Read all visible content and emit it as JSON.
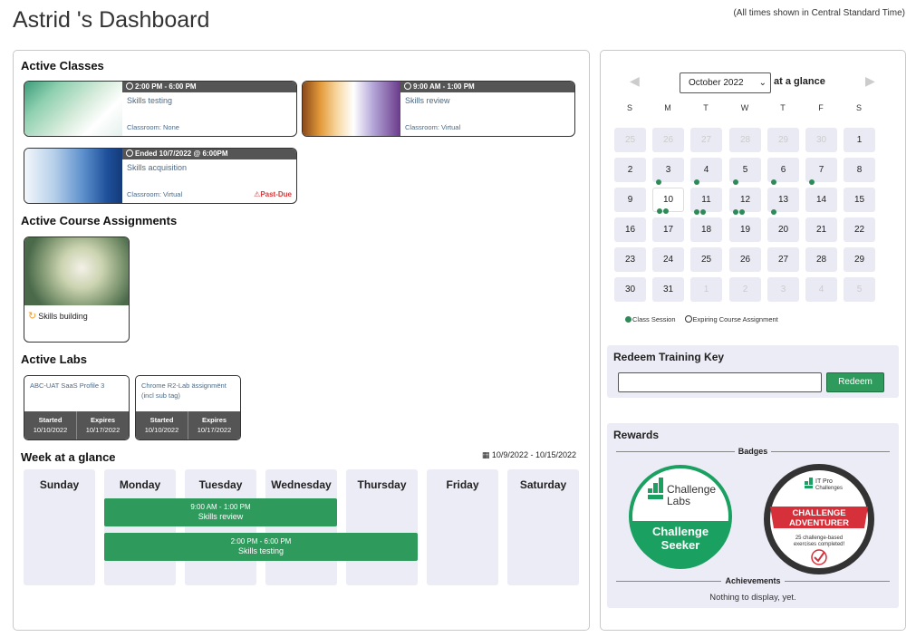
{
  "header": {
    "title": "Astrid 's Dashboard",
    "timezone_note": "(All times shown in Central Standard Time)"
  },
  "active_classes": {
    "title": "Active Classes",
    "cards": [
      {
        "time": "2:00 PM - 6:00 PM",
        "name": "Skills testing",
        "classroom": "Classroom: None",
        "status": ""
      },
      {
        "time": "9:00 AM - 1:00 PM",
        "name": "Skills review",
        "classroom": "Classroom: Virtual",
        "status": ""
      },
      {
        "time": "Ended 10/7/2022 @ 6:00PM",
        "name": "Skills acquisition",
        "classroom": "Classroom: Virtual",
        "status": "⚠Past-Due"
      }
    ]
  },
  "assignments": {
    "title": "Active Course Assignments",
    "items": [
      {
        "name": "Skills building"
      }
    ]
  },
  "labs": {
    "title": "Active Labs",
    "items": [
      {
        "name": "ABC-UAT SaaS Profile 3",
        "started_label": "Started",
        "started": "10/10/2022",
        "expires_label": "Expires",
        "expires": "10/17/2022"
      },
      {
        "name": "Chrome R2-Lab ässignmënt (incl sub tag)",
        "started_label": "Started",
        "started": "10/10/2022",
        "expires_label": "Expires",
        "expires": "10/17/2022"
      }
    ]
  },
  "week": {
    "title": "Week at a glance",
    "range": "10/9/2022 - 10/15/2022",
    "days": [
      "Sunday",
      "Monday",
      "Tuesday",
      "Wednesday",
      "Thursday",
      "Friday",
      "Saturday"
    ],
    "events": [
      {
        "time": "9:00 AM - 1:00 PM",
        "name": "Skills review"
      },
      {
        "time": "2:00 PM - 6:00 PM",
        "name": "Skills testing"
      }
    ]
  },
  "calendar": {
    "prev": "◀",
    "next": "▶",
    "month": "October 2022",
    "at_glance": "at a glance",
    "dow": [
      "S",
      "M",
      "T",
      "W",
      "T",
      "F",
      "S"
    ],
    "weeks": [
      [
        {
          "d": "25",
          "m": true
        },
        {
          "d": "26",
          "m": true
        },
        {
          "d": "27",
          "m": true
        },
        {
          "d": "28",
          "m": true
        },
        {
          "d": "29",
          "m": true
        },
        {
          "d": "30",
          "m": true
        },
        {
          "d": "1"
        }
      ],
      [
        {
          "d": "2"
        },
        {
          "d": "3",
          "dots": 1
        },
        {
          "d": "4",
          "dots": 1
        },
        {
          "d": "5",
          "dots": 1
        },
        {
          "d": "6",
          "dots": 1
        },
        {
          "d": "7",
          "dots": 1
        },
        {
          "d": "8"
        }
      ],
      [
        {
          "d": "9"
        },
        {
          "d": "10",
          "dots": 2,
          "today": true
        },
        {
          "d": "11",
          "dots": 2
        },
        {
          "d": "12",
          "dots": 2
        },
        {
          "d": "13",
          "dots": 1
        },
        {
          "d": "14"
        },
        {
          "d": "15"
        }
      ],
      [
        {
          "d": "16"
        },
        {
          "d": "17"
        },
        {
          "d": "18"
        },
        {
          "d": "19"
        },
        {
          "d": "20"
        },
        {
          "d": "21"
        },
        {
          "d": "22"
        }
      ],
      [
        {
          "d": "23"
        },
        {
          "d": "24"
        },
        {
          "d": "25"
        },
        {
          "d": "26"
        },
        {
          "d": "27"
        },
        {
          "d": "28"
        },
        {
          "d": "29"
        }
      ],
      [
        {
          "d": "30"
        },
        {
          "d": "31"
        },
        {
          "d": "1",
          "m": true
        },
        {
          "d": "2",
          "m": true
        },
        {
          "d": "3",
          "m": true
        },
        {
          "d": "4",
          "m": true
        },
        {
          "d": "5",
          "m": true
        }
      ]
    ],
    "legend_session": "Class Session",
    "legend_expiring": "Expiring Course Assignment"
  },
  "redeem": {
    "title": "Redeem Training Key",
    "placeholder": "",
    "button": "Redeem"
  },
  "rewards": {
    "title": "Rewards",
    "badges_label": "Badges",
    "badge1": {
      "line1": "Challenge",
      "line2": "Labs",
      "name1": "Challenge",
      "name2": "Seeker"
    },
    "badge2": {
      "top1": "IT Pro",
      "top2": "Challenges",
      "name1": "CHALLENGE",
      "name2": "ADVENTURER",
      "sub1": "25 challenge-based",
      "sub2": "exercises completed!"
    },
    "achievements_label": "Achievements",
    "achievements_empty": "Nothing to display, yet."
  },
  "colors": {
    "accent_green": "#2e9a5b",
    "past_due_red": "#d9383a",
    "panel_bg": "#ececf6"
  }
}
